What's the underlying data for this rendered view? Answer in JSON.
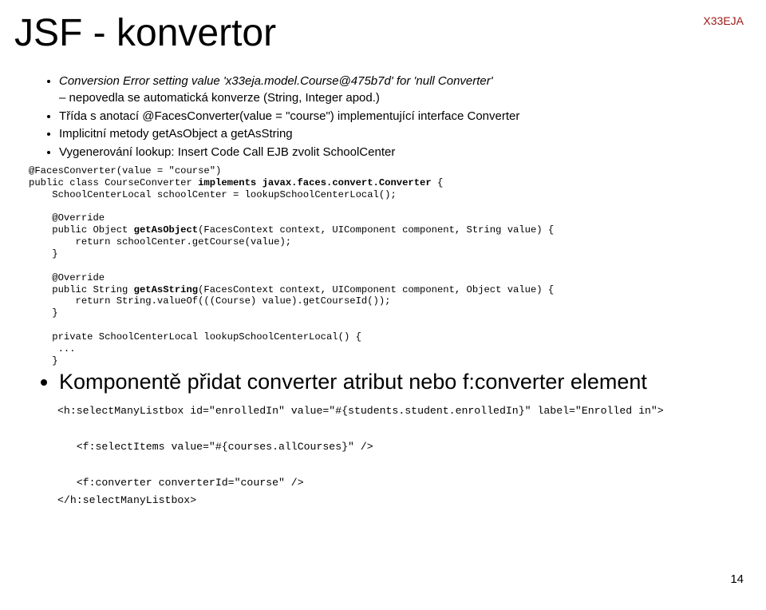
{
  "header_tag": "X33EJA",
  "title": "JSF - konvertor",
  "bullets": {
    "b1_main_italic": "Conversion Error setting value 'x33eja.model.Course@475b7d' for 'null Converter'",
    "b1_sub": "nepovedla se automatická konverze (String, Integer apod.)",
    "b2": "Třída s anotací @FacesConverter(value = \"course\") implementující interface Converter",
    "b3": "Implicitní metody getAsObject a getAsString",
    "b4": "Vygenerování lookup: Insert Code Call EJB zvolit SchoolCenter"
  },
  "code_prefix": "@FacesConverter(value = \"course\")\npublic class CourseConverter ",
  "code_impl_kw": "implements",
  "code_impl_type": " javax.faces.convert.Converter",
  "code_body1": " {\n    SchoolCenterLocal schoolCenter = lookupSchoolCenterLocal();\n\n    @Override\n    public Object ",
  "code_m1_name": "getAsObject",
  "code_m1_rest": "(FacesContext context, UIComponent component, String value) {\n        return schoolCenter.getCourse(value);\n    }\n\n    @Override\n    public String ",
  "code_m2_name": "getAsString",
  "code_m2_rest": "(FacesContext context, UIComponent component, Object value) {\n        return String.valueOf(((Course) value).getCourseId());\n    }\n\n    private SchoolCenterLocal lookupSchoolCenterLocal() {\n     ...\n    }",
  "big_bullet": "Komponentě přidat converter atribut nebo f:converter element",
  "xml": "<h:selectManyListbox id=\"enrolledIn\" value=\"#{students.student.enrolledIn}\" label=\"Enrolled in\">\n\n   <f:selectItems value=\"#{courses.allCourses}\" />\n\n   <f:converter converterId=\"course\" />\n</h:selectManyListbox>",
  "page_num": "14"
}
